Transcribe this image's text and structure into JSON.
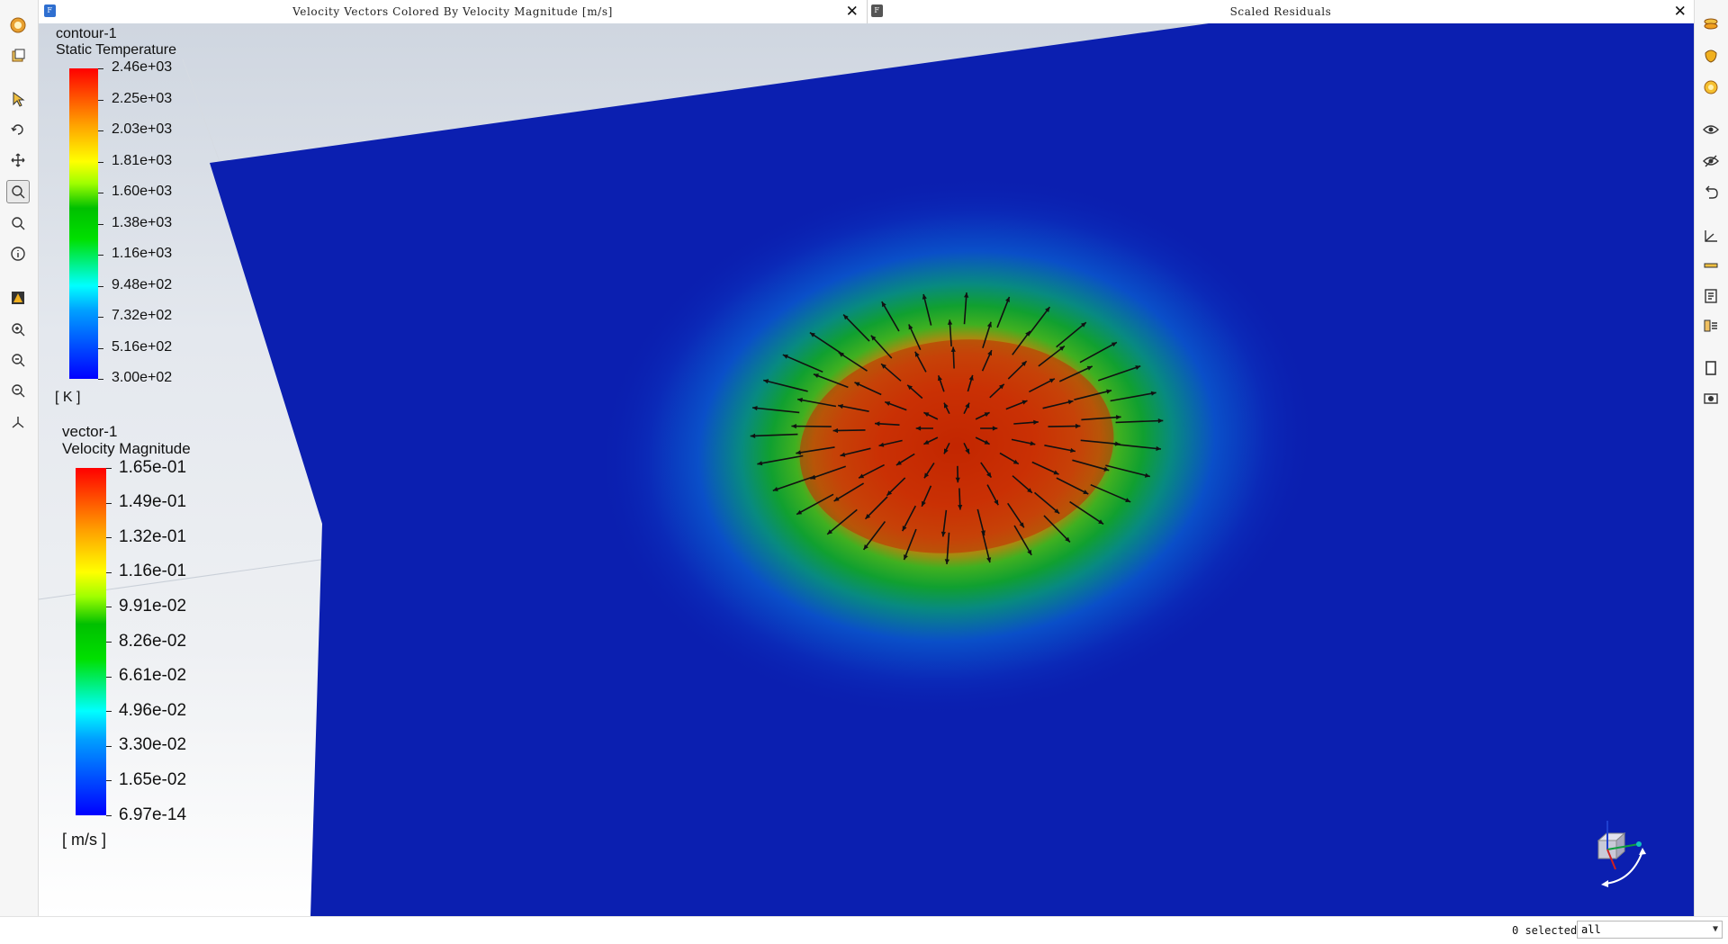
{
  "windows": {
    "left_title": "Velocity Vectors Colored By Velocity Magnitude [m/s]",
    "right_title": "Scaled Residuals",
    "close_glyph": "✕"
  },
  "legend_temperature": {
    "name": "contour-1",
    "quantity": "Static Temperature",
    "unit": "[ K ]",
    "ticks": [
      "2.46e+03",
      "2.25e+03",
      "2.03e+03",
      "1.81e+03",
      "1.60e+03",
      "1.38e+03",
      "1.16e+03",
      "9.48e+02",
      "7.32e+02",
      "5.16e+02",
      "3.00e+02"
    ]
  },
  "legend_velocity": {
    "name": "vector-1",
    "quantity": "Velocity Magnitude",
    "unit": "[ m/s ]",
    "ticks": [
      "1.65e-01",
      "1.49e-01",
      "1.32e-01",
      "1.16e-01",
      "9.91e-02",
      "8.26e-02",
      "6.61e-02",
      "4.96e-02",
      "3.30e-02",
      "1.65e-02",
      "6.97e-14"
    ]
  },
  "colormap": {
    "low": "#0000ff",
    "mid": "#00c000",
    "high": "#ff0000",
    "domain_background": "#0b1fb0",
    "vector_color": "#111111"
  },
  "left_toolbar_icons": [
    "fluent-logo-icon",
    "copy-view-icon",
    "select-pointer-icon",
    "rotate-icon",
    "pan-icon",
    "zoom-rectangle-icon",
    "zoom-icon",
    "probe-info-icon",
    "highlight-icon",
    "zoom-in-icon",
    "zoom-to-fit-icon",
    "zoom-out-icon",
    "axes-orient-icon"
  ],
  "right_toolbar_icons": [
    "layers-icon",
    "shape-icon",
    "lighting-icon",
    "view-eye-icon",
    "hide-eye-icon",
    "undo-view-icon",
    "axes-icon",
    "ruler-icon",
    "notes-icon",
    "compare-icon",
    "page-icon",
    "camera-icon"
  ],
  "status": {
    "selected": "0 selected",
    "filter_value": "all"
  }
}
